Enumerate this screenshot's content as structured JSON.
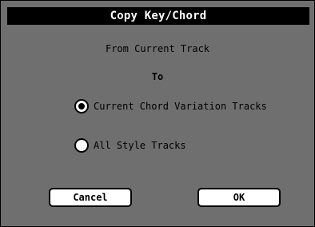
{
  "dialog": {
    "title": "Copy Key/Chord",
    "from_text": "From Current Track",
    "to_text": "To",
    "options": [
      {
        "label": "Current Chord Variation Tracks",
        "selected": true
      },
      {
        "label": "All Style Tracks",
        "selected": false
      }
    ],
    "cancel_label": "Cancel",
    "ok_label": "OK"
  },
  "colors": {
    "background": "#6f6f6f",
    "title_bar": "#000000",
    "title_text": "#ffffff"
  }
}
